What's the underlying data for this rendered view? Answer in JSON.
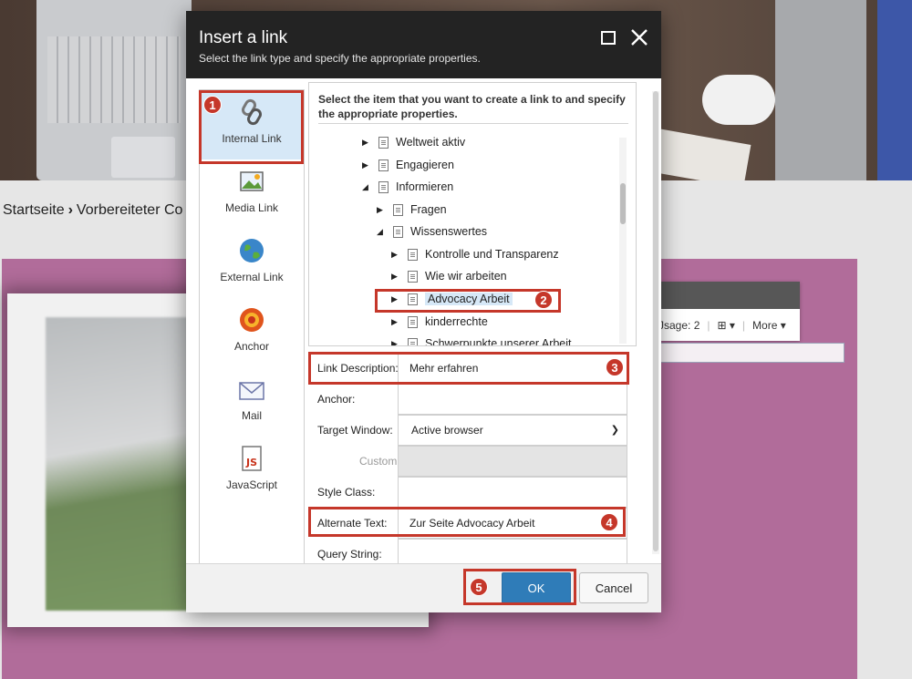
{
  "background": {
    "breadcrumb": {
      "home": "Startseite",
      "separator": "›",
      "current": "Vorbereiteter Co"
    },
    "editor_toolbar": {
      "usage": "Jsage: 2",
      "more": "More"
    }
  },
  "dialog": {
    "title": "Insert a link",
    "subtitle": "Select the link type and specify the appropriate properties.",
    "link_types": [
      {
        "label": "Internal Link",
        "icon": "chain-link-icon",
        "selected": true
      },
      {
        "label": "Media Link",
        "icon": "image-icon"
      },
      {
        "label": "External Link",
        "icon": "globe-icon"
      },
      {
        "label": "Anchor",
        "icon": "anchor-target-icon"
      },
      {
        "label": "Mail",
        "icon": "envelope-icon"
      },
      {
        "label": "JavaScript",
        "icon": "javascript-file-icon"
      }
    ],
    "tree": {
      "instructions": "Select the item that you want to create a link to and specify the appropriate properties.",
      "nodes": [
        {
          "label": "Weltweit aktiv",
          "expanded": false,
          "level": 0
        },
        {
          "label": "Engagieren",
          "expanded": false,
          "level": 0
        },
        {
          "label": "Informieren",
          "expanded": true,
          "level": 0
        },
        {
          "label": "Fragen",
          "expanded": false,
          "level": 1
        },
        {
          "label": "Wissenswertes",
          "expanded": true,
          "level": 1
        },
        {
          "label": "Kontrolle und Transparenz",
          "expanded": false,
          "level": 2
        },
        {
          "label": "Wie wir arbeiten",
          "expanded": false,
          "level": 2
        },
        {
          "label": "Advocacy Arbeit",
          "expanded": false,
          "level": 2,
          "selected": true
        },
        {
          "label": "kinderrechte",
          "expanded": false,
          "level": 2
        },
        {
          "label": "Schwerpunkte unserer Arbeit",
          "expanded": false,
          "level": 2
        }
      ]
    },
    "fields": {
      "link_description": {
        "label": "Link Description:",
        "value": "Mehr erfahren"
      },
      "anchor": {
        "label": "Anchor:",
        "value": ""
      },
      "target_window": {
        "label": "Target Window:",
        "value": "Active browser"
      },
      "custom": {
        "label": "Custom:",
        "value": ""
      },
      "style_class": {
        "label": "Style Class:",
        "value": ""
      },
      "alternate_text": {
        "label": "Alternate Text:",
        "value": "Zur Seite Advocacy Arbeit"
      },
      "query_string": {
        "label": "Query String:",
        "value": ""
      }
    },
    "buttons": {
      "ok": "OK",
      "cancel": "Cancel"
    }
  },
  "callouts": [
    "1",
    "2",
    "3",
    "4",
    "5"
  ],
  "colors": {
    "header_bg": "#232323",
    "primary_button": "#2f7cb8",
    "callout": "#c5372a",
    "selected_bg": "#d6e8f7"
  }
}
